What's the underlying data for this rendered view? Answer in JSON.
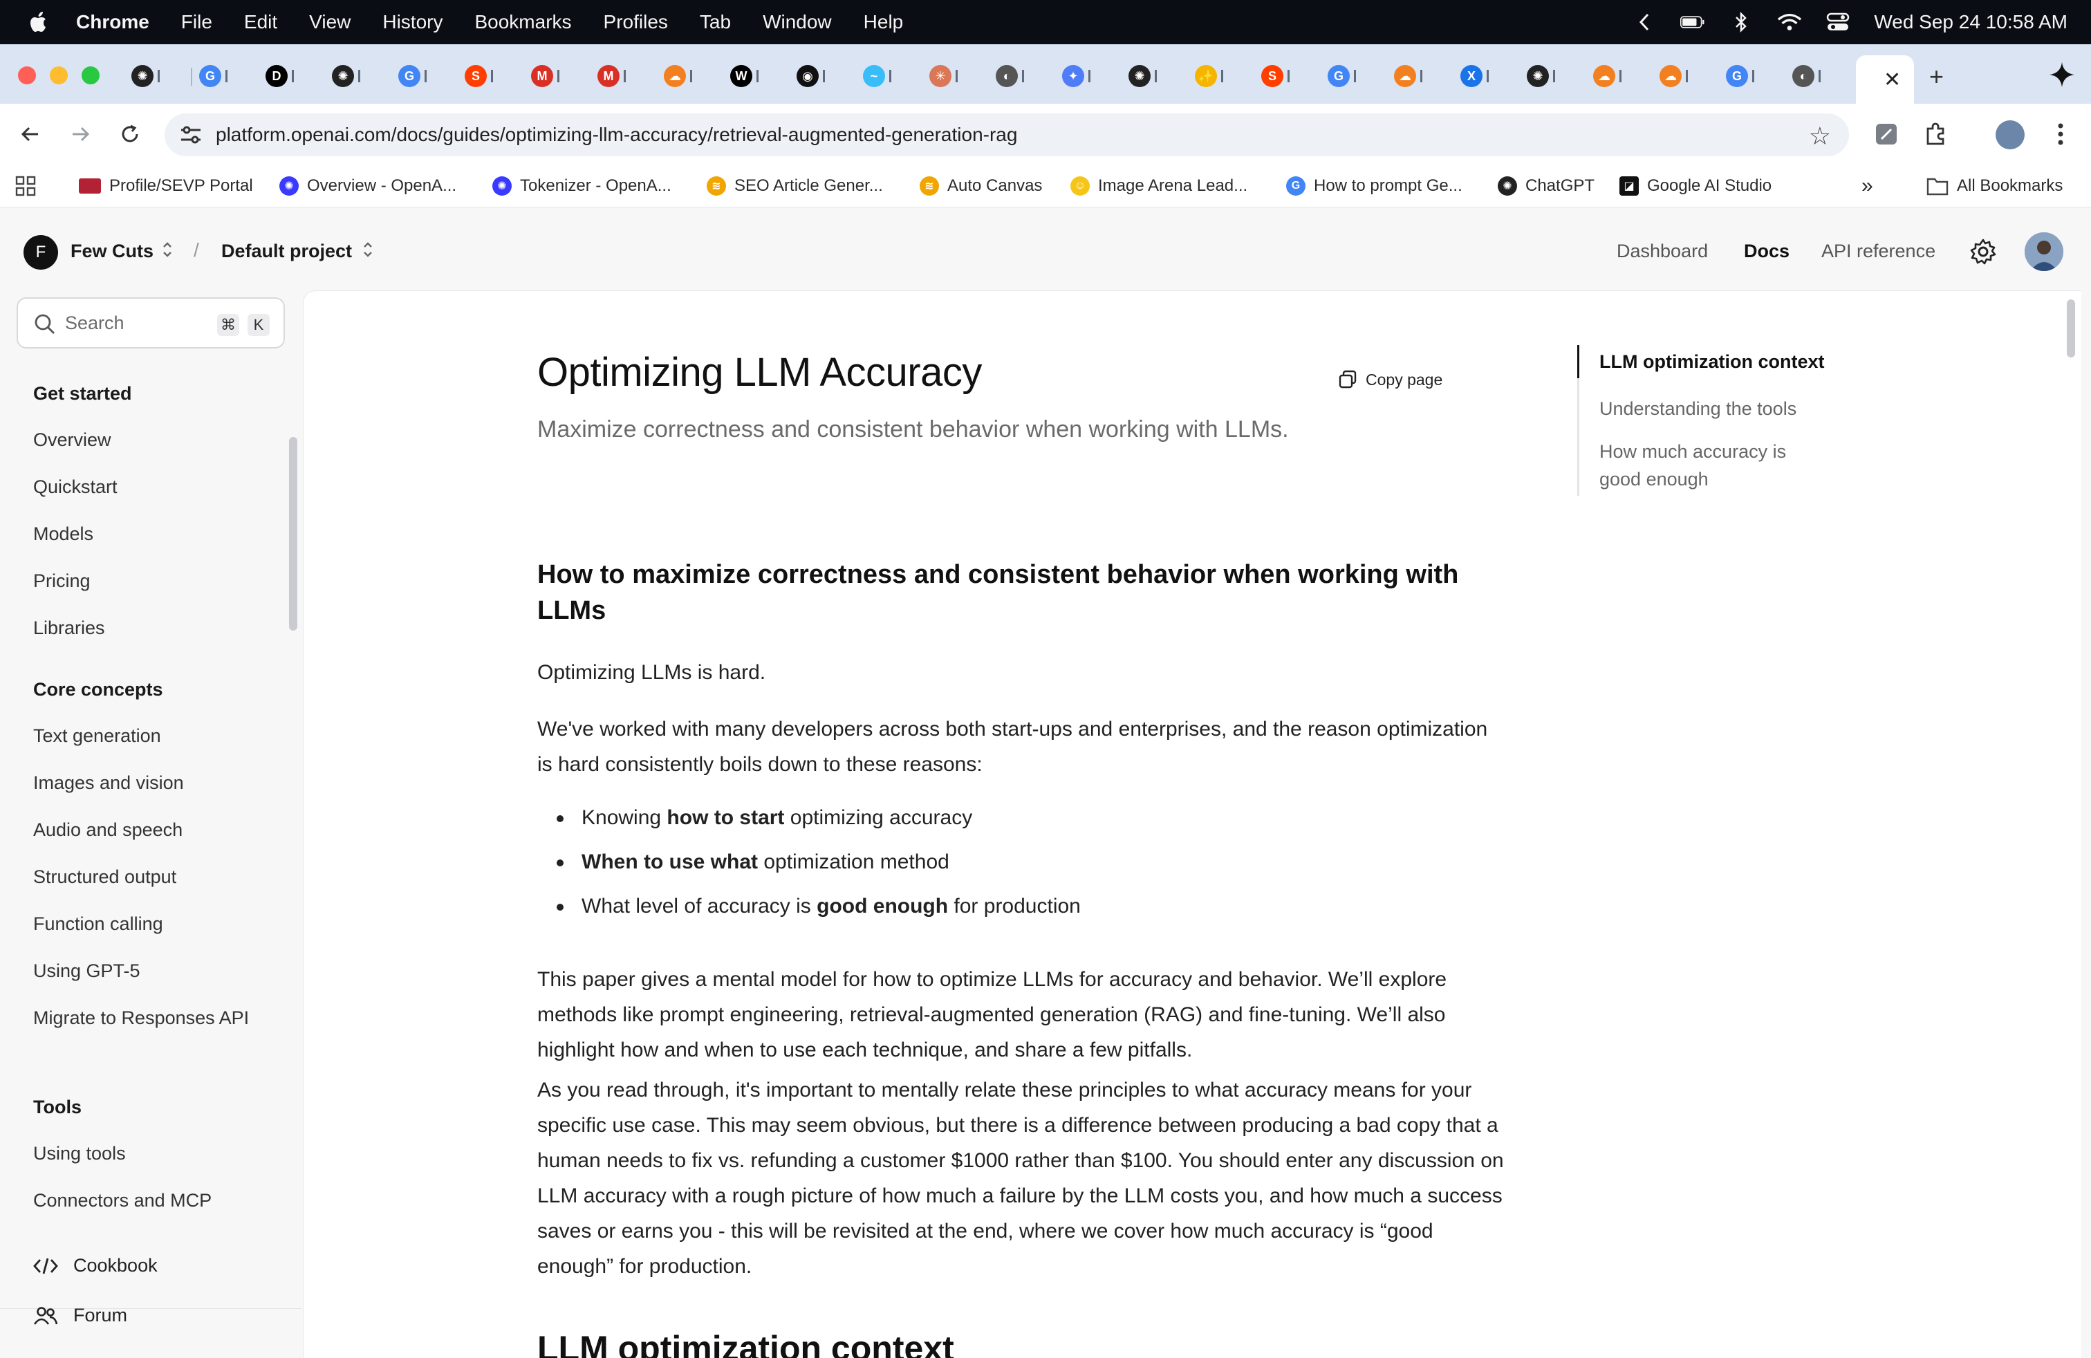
{
  "menubar": {
    "app": "Chrome",
    "items": [
      "File",
      "Edit",
      "View",
      "History",
      "Bookmarks",
      "Profiles",
      "Tab",
      "Window",
      "Help"
    ],
    "clock": "Wed Sep 24  10:58 AM"
  },
  "browser": {
    "url": "platform.openai.com/docs/guides/optimizing-llm-accuracy/retrieval-augmented-generation-rag",
    "bookmarks": [
      "Profile/SEVP Portal",
      "Overview - OpenA...",
      "Tokenizer - OpenA...",
      "SEO Article Gener...",
      "Auto Canvas",
      "Image Arena Lead...",
      "How to prompt Ge...",
      "ChatGPT",
      "Google AI Studio"
    ],
    "all_bookmarks": "All Bookmarks",
    "overflow": "»"
  },
  "topnav": {
    "org_initial": "F",
    "org": "Few Cuts",
    "separator": "/",
    "project": "Default project",
    "links": [
      "Dashboard",
      "Docs",
      "API reference"
    ]
  },
  "sidebar": {
    "search_placeholder": "Search",
    "shortcut": [
      "⌘",
      "K"
    ],
    "sections": [
      {
        "title": "Get started",
        "items": [
          "Overview",
          "Quickstart",
          "Models",
          "Pricing",
          "Libraries"
        ]
      },
      {
        "title": "Core concepts",
        "items": [
          "Text generation",
          "Images and vision",
          "Audio and speech",
          "Structured output",
          "Function calling",
          "Using GPT-5",
          "Migrate to Responses API"
        ]
      },
      {
        "title": "Tools",
        "items": [
          "Using tools",
          "Connectors and MCP"
        ]
      }
    ],
    "footer": [
      "Cookbook",
      "Forum"
    ]
  },
  "doc": {
    "title": "Optimizing LLM Accuracy",
    "subtitle": "Maximize correctness and consistent behavior when working with LLMs.",
    "copy_label": "Copy page",
    "h2": "How to maximize correctness and consistent behavior when working with LLMs",
    "p1": "Optimizing LLMs is hard.",
    "p2": "We've worked with many developers across both start-ups and enterprises, and the reason optimization is hard consistently boils down to these reasons:",
    "bullets": [
      {
        "pre": "Knowing ",
        "bold": "how to start",
        "post": " optimizing accuracy"
      },
      {
        "pre": "",
        "bold": "When to use what",
        "post": " optimization method"
      },
      {
        "pre": "What level of accuracy is ",
        "bold": "good enough",
        "post": " for production"
      }
    ],
    "p3": "This paper gives a mental model for how to optimize LLMs for accuracy and behavior. We’ll explore methods like prompt engineering, retrieval-augmented generation (RAG) and fine-tuning. We’ll also highlight how and when to use each technique, and share a few pitfalls.",
    "p4": "As you read through, it's important to mentally relate these principles to what accuracy means for your specific use case. This may seem obvious, but there is a difference between producing a bad copy that a human needs to fix vs. refunding a customer $1000 rather than $100. You should enter any discussion on LLM accuracy with a rough picture of how much a failure by the LLM costs you, and how much a success saves or earns you - this will be revisited at the end, where we cover how much accuracy is “good enough” for production.",
    "next_heading": "LLM optimization context"
  },
  "toc": {
    "items": [
      "LLM optimization context",
      "Understanding the tools",
      "How much accuracy is good enough"
    ]
  }
}
